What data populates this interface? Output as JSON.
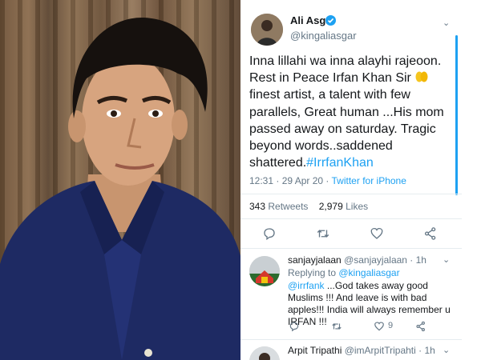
{
  "tweet": {
    "author_name": "Ali Asgar",
    "author_handle": "@kingaliasgar",
    "text_main": "Inna lillahi wa inna alayhi rajeoon. Rest in Peace Irfan Khan Sir",
    "text_rest": "finest artist, a talent with few parallels, Great human ...His mom passed away on saturday. Tragic beyond words..saddened shattered.",
    "hashtag": "#IrrfanKhan",
    "time": "12:31 · 29 Apr 20 · ",
    "source": "Twitter for iPhone",
    "retweets": "343",
    "retweets_label": "Retweets",
    "likes": "2,979",
    "likes_label": "Likes"
  },
  "replies": [
    {
      "name": "sanjayjalaan",
      "handle": "@sanjayjalaan · 1h",
      "replying_label": "Replying to ",
      "replying_to": "@kingaliasgar",
      "mention": "@irrfank",
      "text": " ...God takes away good Muslims !!! And leave is with bad apples!!! India will always remember u IRFAN !!!",
      "like_count": "9"
    },
    {
      "name": "Arpit Tripathi",
      "handle": "@imArpitTripahti · 1h"
    }
  ],
  "icons": [
    "verified-icon",
    "chevron-down-icon",
    "reply-icon",
    "retweet-icon",
    "like-icon",
    "share-icon"
  ],
  "colors": {
    "accent": "#1da1f2",
    "muted": "#657786",
    "text": "#14171a",
    "divider": "#e6ecf0"
  }
}
